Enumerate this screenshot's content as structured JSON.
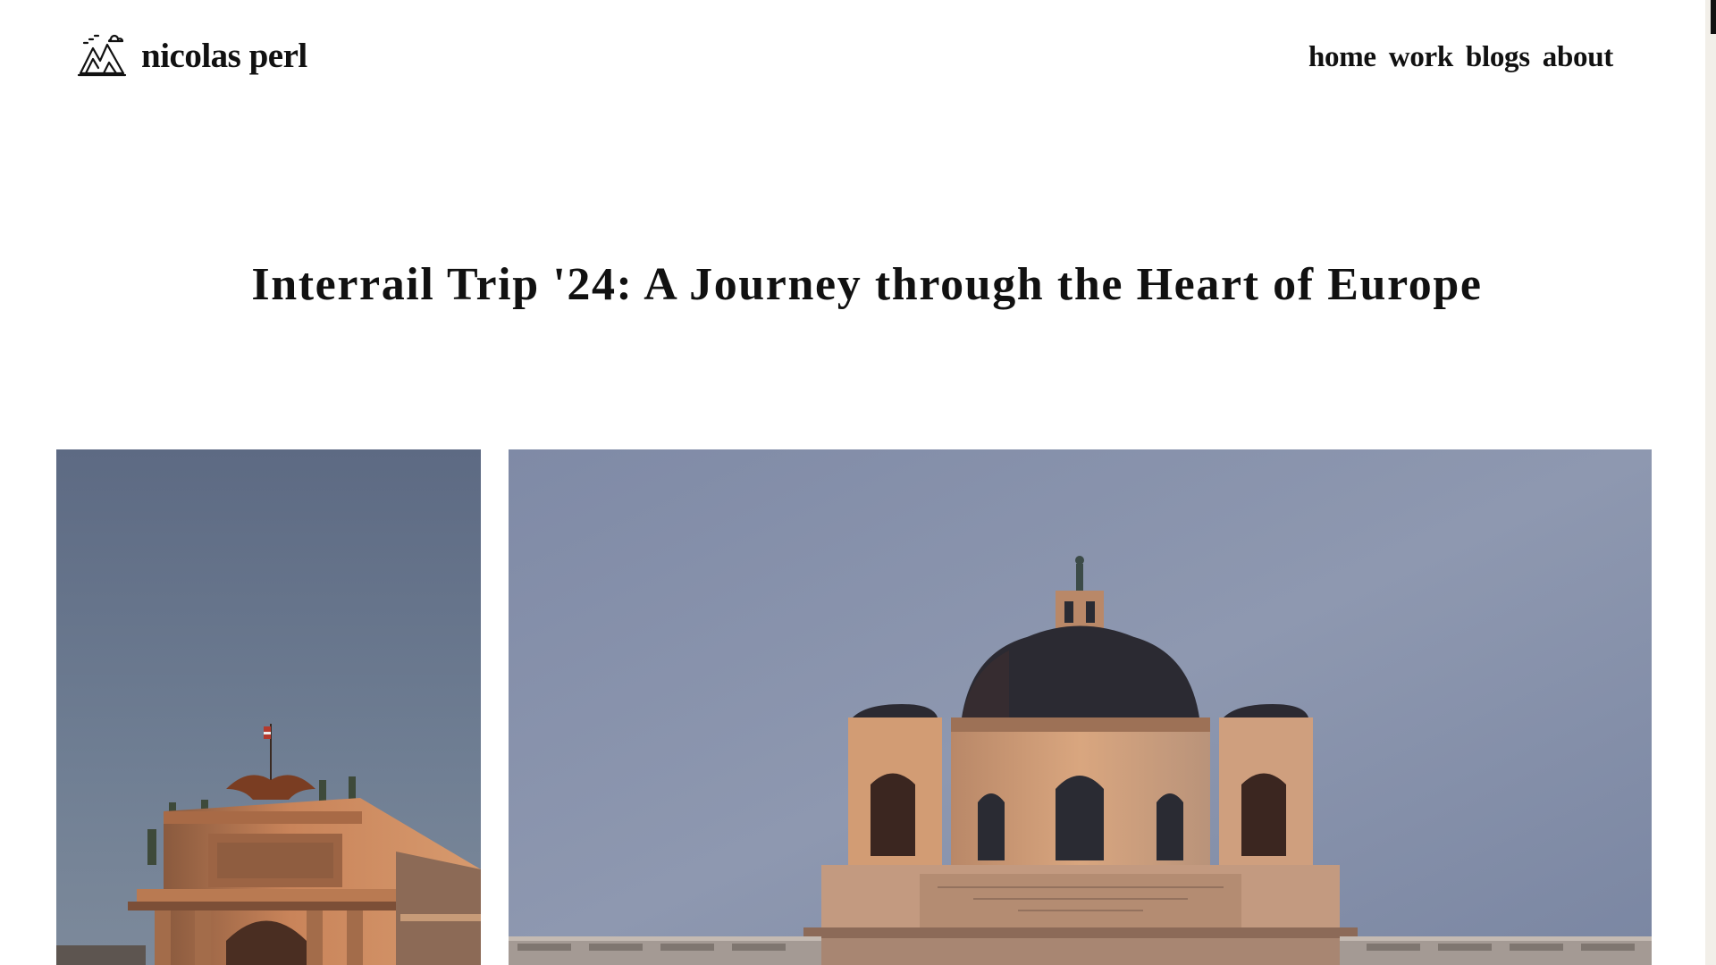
{
  "header": {
    "site_name": "nicolas perl",
    "logo_icon": "mountains-icon"
  },
  "nav": {
    "items": [
      {
        "label": "home"
      },
      {
        "label": "work"
      },
      {
        "label": "blogs"
      },
      {
        "label": "about"
      }
    ]
  },
  "post": {
    "title": "Interrail Trip '24: A Journey through the Heart of Europe"
  },
  "gallery": {
    "images": [
      {
        "subject": "ornate palace rooftop with eagle statue at sunset"
      },
      {
        "subject": "domed museum facade with towers at sunset"
      }
    ]
  },
  "colors": {
    "text": "#111111",
    "background": "#ffffff",
    "sky_top": "#6b7a92",
    "sky_bottom": "#9aa3b9",
    "stone_lit": "#c98b5f"
  }
}
